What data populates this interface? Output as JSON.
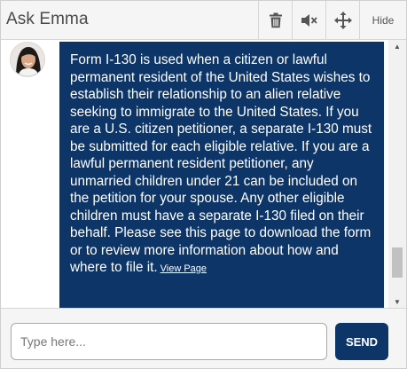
{
  "header": {
    "title": "Ask Emma",
    "hide_label": "Hide",
    "icons": [
      "trash-icon",
      "mute-icon",
      "move-icon"
    ]
  },
  "chat": {
    "message": "Form I-130 is used when a citizen or lawful permanent resident of the United States wishes to establish their relationship to an alien relative seeking to immigrate to the United States. If you are a U.S. citizen petitioner, a separate I-130 must be submitted for each eligible relative. If you are a lawful permanent resident petitioner, any unmarried children under 21 can be included on the petition for your spouse. Any other eligible children must have a separate I-130 filed on their behalf. Please see this page to download the form or to review more information about how and where to file it.",
    "link_text": "View Page"
  },
  "footer": {
    "input_placeholder": "Type here...",
    "input_value": "",
    "send_label": "SEND"
  },
  "colors": {
    "bubble": "#0d3567",
    "send_button": "#0d3567",
    "header_bg": "#f5f5f5"
  }
}
